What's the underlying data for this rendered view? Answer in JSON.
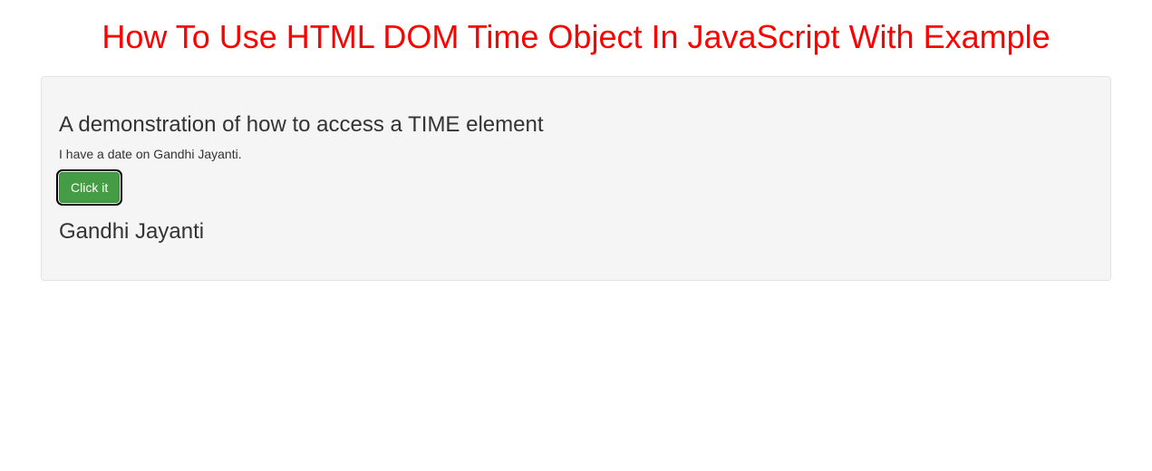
{
  "header": {
    "title": "How To Use HTML DOM Time Object In JavaScript With Example"
  },
  "well": {
    "heading": "A demonstration of how to access a TIME element",
    "paragraph": "I have a date on Gandhi Jayanti.",
    "button_label": "Click it",
    "result": "Gandhi Jayanti"
  }
}
